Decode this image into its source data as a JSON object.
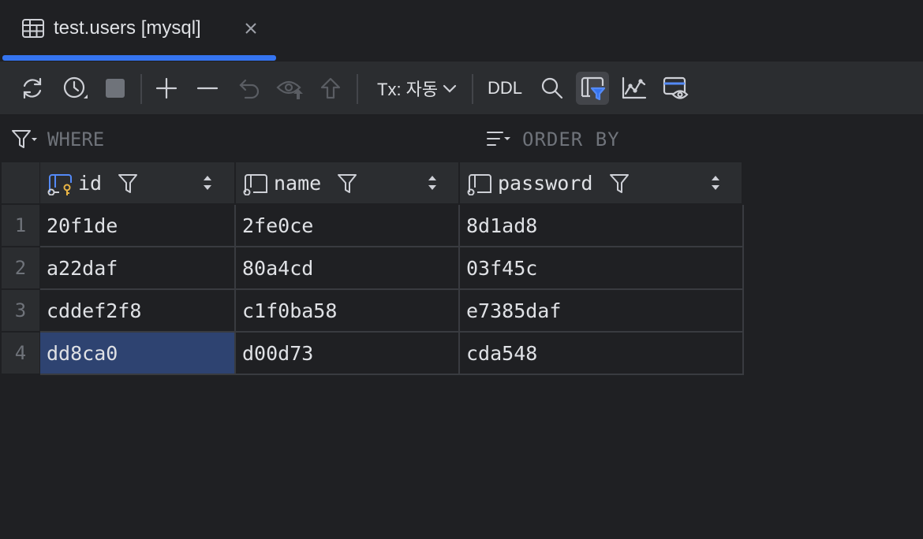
{
  "tab": {
    "title": "test.users [mysql]",
    "icon": "table-icon",
    "close_icon": "close-icon"
  },
  "toolbar": {
    "tx_label": "Tx: 자동",
    "ddl_label": "DDL",
    "buttons": [
      "refresh-icon",
      "history-icon",
      "stop-icon",
      "add-row-icon",
      "delete-row-icon",
      "revert-icon",
      "preview-icon",
      "submit-icon",
      "search-icon",
      "filter-icon",
      "chart-icon",
      "view-icon"
    ]
  },
  "filters": {
    "where": "WHERE",
    "order_by": "ORDER BY"
  },
  "columns": [
    {
      "name": "id",
      "icon": "primary-key-column-icon"
    },
    {
      "name": "name",
      "icon": "column-icon"
    },
    {
      "name": "password",
      "icon": "column-icon"
    }
  ],
  "rows": [
    {
      "num": "1",
      "cells": [
        "20f1de",
        "2fe0ce",
        "8d1ad8"
      ]
    },
    {
      "num": "2",
      "cells": [
        "a22daf",
        "80a4cd",
        "03f45c"
      ]
    },
    {
      "num": "3",
      "cells": [
        "cddef2f8",
        "c1f0ba58",
        "e7385daf"
      ]
    },
    {
      "num": "4",
      "cells": [
        "dd8ca0",
        "d00d73",
        "cda548"
      ]
    }
  ],
  "selected_cell": {
    "row": 4,
    "column": "id"
  },
  "colors": {
    "accent": "#3574f0",
    "selection": "#2e4371",
    "background": "#1f2023",
    "toolbar": "#2b2d30"
  }
}
